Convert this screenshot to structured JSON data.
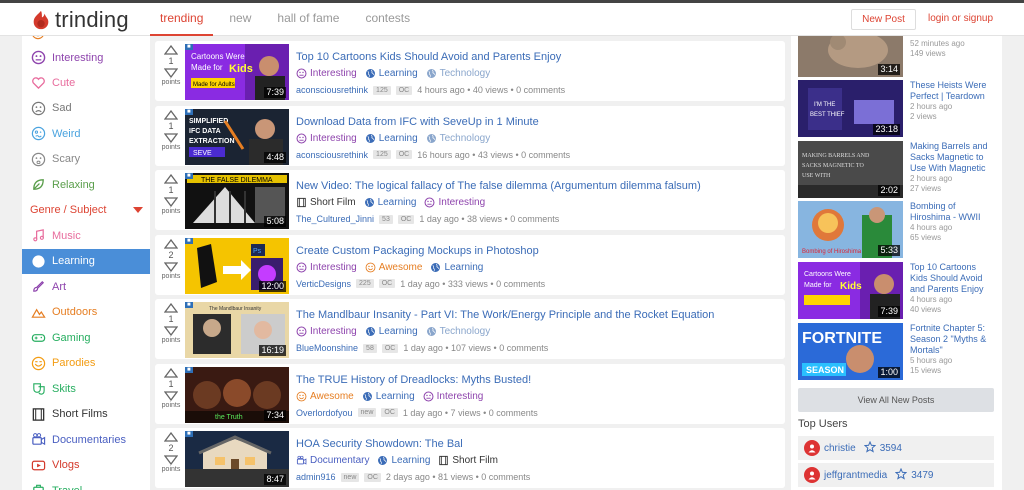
{
  "brand": {
    "name": "trinding",
    "logo_color": "#d43a2c"
  },
  "nav": {
    "tabs": [
      "trending",
      "new",
      "hall of fame",
      "contests"
    ],
    "active": "trending"
  },
  "header": {
    "new_post": "New Post",
    "login": "login or signup"
  },
  "sidebar": {
    "items_top": [
      {
        "label": "Interesting",
        "icon": "interesting-icon",
        "color": "#8e44ad"
      },
      {
        "label": "Cute",
        "icon": "heart-icon",
        "color": "#e86c9d"
      },
      {
        "label": "Sad",
        "icon": "sad-face-icon",
        "color": "#777777"
      },
      {
        "label": "Weird",
        "icon": "weird-face-icon",
        "color": "#4aa3df"
      },
      {
        "label": "Scary",
        "icon": "scary-face-icon",
        "color": "#888888"
      },
      {
        "label": "Relaxing",
        "icon": "leaf-icon",
        "color": "#5a9e4b"
      }
    ],
    "section_header": "Genre / Subject",
    "items_genre": [
      {
        "label": "Music",
        "icon": "music-icon",
        "color": "#e86c9d"
      },
      {
        "label": "Learning",
        "icon": "globe-icon",
        "color": "#ffffff",
        "active": true
      },
      {
        "label": "Art",
        "icon": "paint-icon",
        "color": "#8e44ad"
      },
      {
        "label": "Outdoors",
        "icon": "mountain-icon",
        "color": "#e67e22"
      },
      {
        "label": "Gaming",
        "icon": "gamepad-icon",
        "color": "#27ae60"
      },
      {
        "label": "Parodies",
        "icon": "parody-icon",
        "color": "#f39c12"
      },
      {
        "label": "Skits",
        "icon": "theater-icon",
        "color": "#27ae60"
      },
      {
        "label": "Short Films",
        "icon": "film-icon",
        "color": "#333333"
      },
      {
        "label": "Documentaries",
        "icon": "documentary-icon",
        "color": "#4a5fc1"
      },
      {
        "label": "Vlogs",
        "icon": "vlog-icon",
        "color": "#d43a2c"
      },
      {
        "label": "Travel",
        "icon": "travel-icon",
        "color": "#27ae60"
      }
    ]
  },
  "posts": [
    {
      "points": "1",
      "duration": "7:39",
      "title": "Top 10 Cartoons Kids Should Avoid and Parents Enjoy",
      "cats": [
        {
          "label": "Interesting",
          "icon": "interesting-icon",
          "color": "#8e44ad"
        },
        {
          "label": "Learning",
          "icon": "globe-icon",
          "color": "#3b6cb7"
        },
        {
          "label": "Technology",
          "icon": "globe-icon",
          "color": "#8aa6cc"
        }
      ],
      "user": "aconsciousrethink",
      "badge1": "125",
      "badge2": "OC",
      "meta": "4 hours ago • 40 views • 0 comments"
    },
    {
      "points": "1",
      "duration": "4:48",
      "title": "Download Data from IFC with SeveUp in 1 Minute",
      "cats": [
        {
          "label": "Interesting",
          "icon": "interesting-icon",
          "color": "#8e44ad"
        },
        {
          "label": "Learning",
          "icon": "globe-icon",
          "color": "#3b6cb7"
        },
        {
          "label": "Technology",
          "icon": "globe-icon",
          "color": "#8aa6cc"
        }
      ],
      "user": "aconsciousrethink",
      "badge1": "125",
      "badge2": "OC",
      "meta": "16 hours ago • 43 views • 0 comments"
    },
    {
      "points": "1",
      "duration": "5:08",
      "title": "New Video: The logical fallacy of The false dilemma (Argumentum dilemma falsum)",
      "cats": [
        {
          "label": "Short Film",
          "icon": "film-icon",
          "color": "#333333"
        },
        {
          "label": "Learning",
          "icon": "globe-icon",
          "color": "#3b6cb7"
        },
        {
          "label": "Interesting",
          "icon": "interesting-icon",
          "color": "#8e44ad"
        }
      ],
      "user": "The_Cultured_Jinni",
      "badge1": "53",
      "badge2": "OC",
      "meta": "1 day ago • 38 views • 0 comments"
    },
    {
      "points": "2",
      "duration": "12:00",
      "title": "Create Custom Packaging Mockups in Photoshop",
      "cats": [
        {
          "label": "Interesting",
          "icon": "interesting-icon",
          "color": "#8e44ad"
        },
        {
          "label": "Awesome",
          "icon": "awesome-icon",
          "color": "#e67e22"
        },
        {
          "label": "Learning",
          "icon": "globe-icon",
          "color": "#3b6cb7"
        }
      ],
      "user": "VerticDesigns",
      "badge1": "225",
      "badge2": "OC",
      "meta": "1 day ago • 333 views • 0 comments"
    },
    {
      "points": "1",
      "duration": "16:19",
      "title": "The Mandlbaur Insanity - Part VI: The Work/Energy Principle and the Rocket Equation",
      "cats": [
        {
          "label": "Interesting",
          "icon": "interesting-icon",
          "color": "#8e44ad"
        },
        {
          "label": "Learning",
          "icon": "globe-icon",
          "color": "#3b6cb7"
        },
        {
          "label": "Technology",
          "icon": "globe-icon",
          "color": "#8aa6cc"
        }
      ],
      "user": "BlueMoonshine",
      "badge1": "58",
      "badge2": "OC",
      "meta": "1 day ago • 107 views • 0 comments"
    },
    {
      "points": "1",
      "duration": "7:34",
      "title": "The TRUE History of Dreadlocks: Myths Busted!",
      "cats": [
        {
          "label": "Awesome",
          "icon": "awesome-icon",
          "color": "#e67e22"
        },
        {
          "label": "Learning",
          "icon": "globe-icon",
          "color": "#3b6cb7"
        },
        {
          "label": "Interesting",
          "icon": "interesting-icon",
          "color": "#8e44ad"
        }
      ],
      "user": "Overlordofyou",
      "badge1": "new",
      "badge2": "OC",
      "meta": "1 day ago • 7 views • 0 comments"
    },
    {
      "points": "2",
      "duration": "8:47",
      "title": "HOA Security Showdown: The Bal",
      "cats": [
        {
          "label": "Documentary",
          "icon": "documentary-icon",
          "color": "#4a5fc1"
        },
        {
          "label": "Learning",
          "icon": "globe-icon",
          "color": "#3b6cb7"
        },
        {
          "label": "Short Film",
          "icon": "film-icon",
          "color": "#333333"
        }
      ],
      "user": "admin916",
      "badge1": "new",
      "badge2": "OC",
      "meta": "2 days ago • 81 views • 0 comments"
    }
  ],
  "votes": {
    "points_label": "points"
  },
  "new_videos": [
    {
      "title": "",
      "duration": "3:14",
      "ago": "52 minutes ago",
      "views": "149 views"
    },
    {
      "title": "These Heists Were Perfect | Teardown",
      "duration": "23:18",
      "ago": "2 hours ago",
      "views": "2 views"
    },
    {
      "title": "Making Barrels and Sacks Magnetic to Use With Magnetic",
      "duration": "2:02",
      "ago": "2 hours ago",
      "views": "27 views"
    },
    {
      "title": "Bombing of Hiroshima - WWII",
      "duration": "5:33",
      "ago": "4 hours ago",
      "views": "65 views"
    },
    {
      "title": "Top 10 Cartoons Kids Should Avoid and Parents Enjoy",
      "duration": "7:39",
      "ago": "4 hours ago",
      "views": "40 views"
    },
    {
      "title": "Fortnite Chapter 5: Season 2 \"Myths & Mortals\"",
      "duration": "1:00",
      "ago": "5 hours ago",
      "views": "15 views"
    }
  ],
  "view_all": "View All New Posts",
  "top_users_label": "Top Users",
  "top_users": [
    {
      "name": "christie",
      "score": "3594"
    },
    {
      "name": "jeffgrantmedia",
      "score": "3479"
    }
  ]
}
